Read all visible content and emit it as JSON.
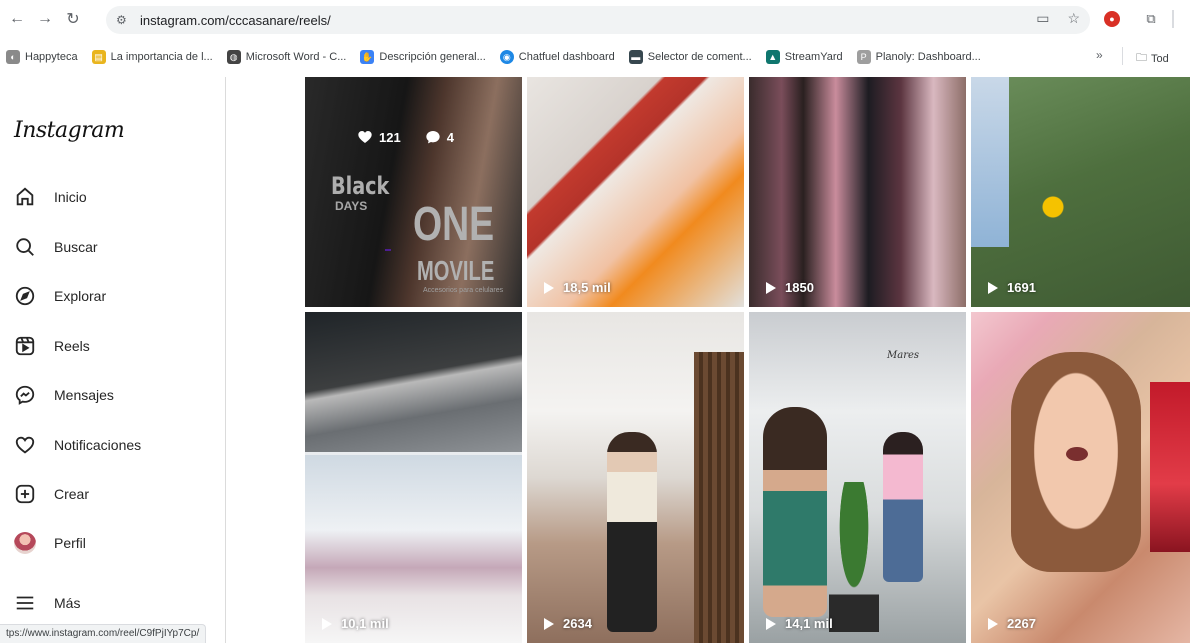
{
  "browser": {
    "url": "instagram.com/cccasanare/reels/",
    "bookmarks": [
      {
        "label": "Happyteca",
        "color": "#8a8a8a"
      },
      {
        "label": "La importancia de l...",
        "color": "#e9b51e"
      },
      {
        "label": "Microsoft Word - C...",
        "color": "#444444"
      },
      {
        "label": "Descripción general...",
        "color": "#3b82f6"
      },
      {
        "label": "Chatfuel dashboard",
        "color": "#1e88e5"
      },
      {
        "label": "Selector de coment...",
        "color": "#37474f"
      },
      {
        "label": "StreamYard",
        "color": "#0f766e"
      },
      {
        "label": "Planoly: Dashboard...",
        "color": "#9e9e9e"
      }
    ],
    "bookmarks_more": "»",
    "bookmarks_all": "Tod",
    "status_url": "tps://www.instagram.com/reel/C9fPjIYp7Cp/"
  },
  "sidebar": {
    "logo": "Instagram",
    "items": [
      {
        "label": "Inicio",
        "icon": "home-icon"
      },
      {
        "label": "Buscar",
        "icon": "search-icon"
      },
      {
        "label": "Explorar",
        "icon": "compass-icon"
      },
      {
        "label": "Reels",
        "icon": "reels-icon"
      },
      {
        "label": "Mensajes",
        "icon": "messenger-icon"
      },
      {
        "label": "Notificaciones",
        "icon": "heart-icon"
      },
      {
        "label": "Crear",
        "icon": "create-icon"
      },
      {
        "label": "Perfil",
        "icon": "avatar"
      },
      {
        "label": "Más",
        "icon": "menu-icon"
      }
    ]
  },
  "reels": [
    {
      "hover": true,
      "likes": "121",
      "comments": "4",
      "overlay": {
        "line1": "Black",
        "line2": "DAYS",
        "line3": "ONE",
        "line4": "MOVILE",
        "tagline": "Accesorios para celulares"
      }
    },
    {
      "views": "18,5 mil"
    },
    {
      "views": "1850"
    },
    {
      "views": "1691"
    },
    {
      "views": "10,1 mil"
    },
    {
      "views": "2634"
    },
    {
      "views": "14,1 mil",
      "sign": "Mares"
    },
    {
      "views": "2267"
    }
  ]
}
